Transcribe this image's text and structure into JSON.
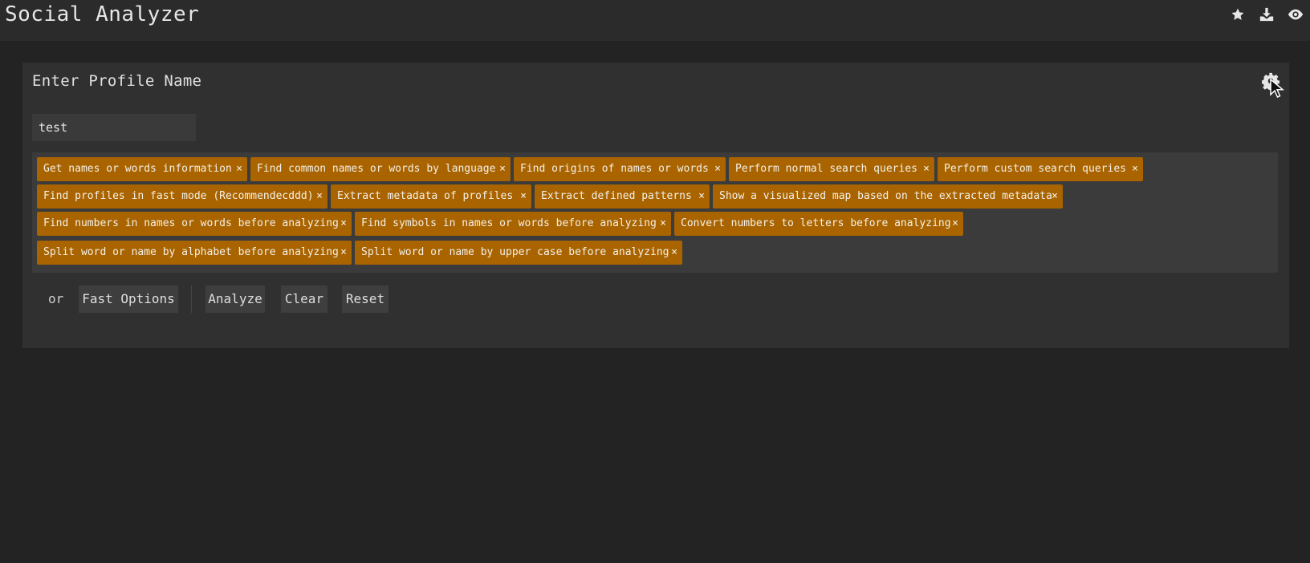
{
  "header": {
    "title": "Social Analyzer",
    "icons": [
      "star-icon",
      "download-icon",
      "eye-icon"
    ]
  },
  "panel": {
    "title": "Enter Profile Name",
    "settings_icon": "gear-icon",
    "input": {
      "value": "test",
      "placeholder": ""
    },
    "tags": [
      {
        "label": "Get names or words information"
      },
      {
        "label": "Find common names or words by language"
      },
      {
        "label": "Find origins of names or words"
      },
      {
        "label": "Perform normal search queries"
      },
      {
        "label": "Perform custom search queries"
      },
      {
        "label": "Find profiles in fast mode (Recommendecddd)"
      },
      {
        "label": "Extract metadata of profiles"
      },
      {
        "label": "Extract defined patterns"
      },
      {
        "label": "Show a visualized map based on the extracted metadata"
      },
      {
        "label": "Find numbers in names or words before analyzing"
      },
      {
        "label": "Find symbols in names or words before analyzing"
      },
      {
        "label": "Convert numbers to letters before analyzing"
      },
      {
        "label": "Split word or name by alphabet before analyzing"
      },
      {
        "label": "Split word or name by upper case before analyzing"
      }
    ],
    "tag_remove_symbol": "×",
    "actions": {
      "or_label": "or",
      "fast_options": "Fast Options",
      "analyze": "Analyze",
      "clear": "Clear",
      "reset": "Reset"
    }
  },
  "colors": {
    "background": "#222322",
    "topbar": "#2a2b2a",
    "panel": "#2f302f",
    "tag": "#a96400"
  }
}
